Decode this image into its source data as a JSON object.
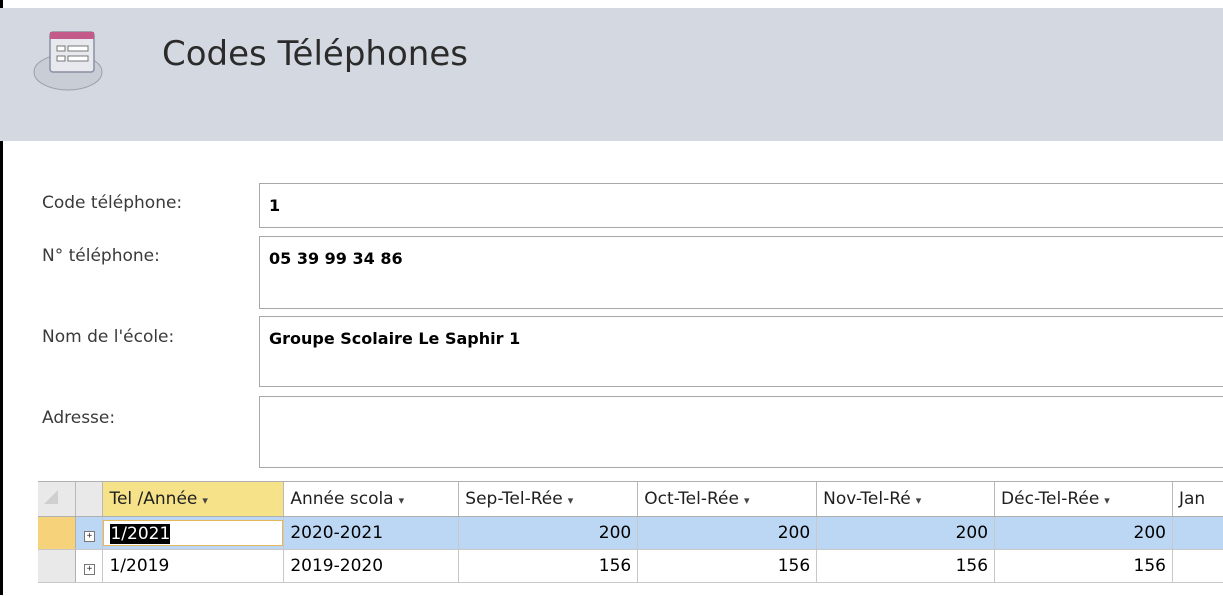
{
  "header": {
    "title": "Codes Téléphones",
    "icon": "form-icon"
  },
  "form": {
    "code_label": "Code téléphone:",
    "code_value": "1",
    "phone_label": "N° téléphone:",
    "phone_value": "05 39 99 34 86",
    "school_label": "Nom de l'école:",
    "school_value": "Groupe Scolaire Le Saphir 1",
    "address_label": "Adresse:",
    "address_value": ""
  },
  "grid": {
    "columns": [
      "Tel /Année",
      "Année scola",
      "Sep-Tel-Rée",
      "Oct-Tel-Rée",
      "Nov-Tel-Ré",
      "Déc-Tel-Rée",
      "Jan"
    ],
    "rows": [
      {
        "c0": "1/2021",
        "c1": "2020-2021",
        "c2": "200",
        "c3": "200",
        "c4": "200",
        "c5": "200",
        "c6": ""
      },
      {
        "c0": "1/2019",
        "c1": "2019-2020",
        "c2": "156",
        "c3": "156",
        "c4": "156",
        "c5": "156",
        "c6": ""
      }
    ]
  },
  "colors": {
    "header_bg": "#d4d8e0",
    "selected_row": "#bcd7f3",
    "active_col": "#f6e289"
  }
}
